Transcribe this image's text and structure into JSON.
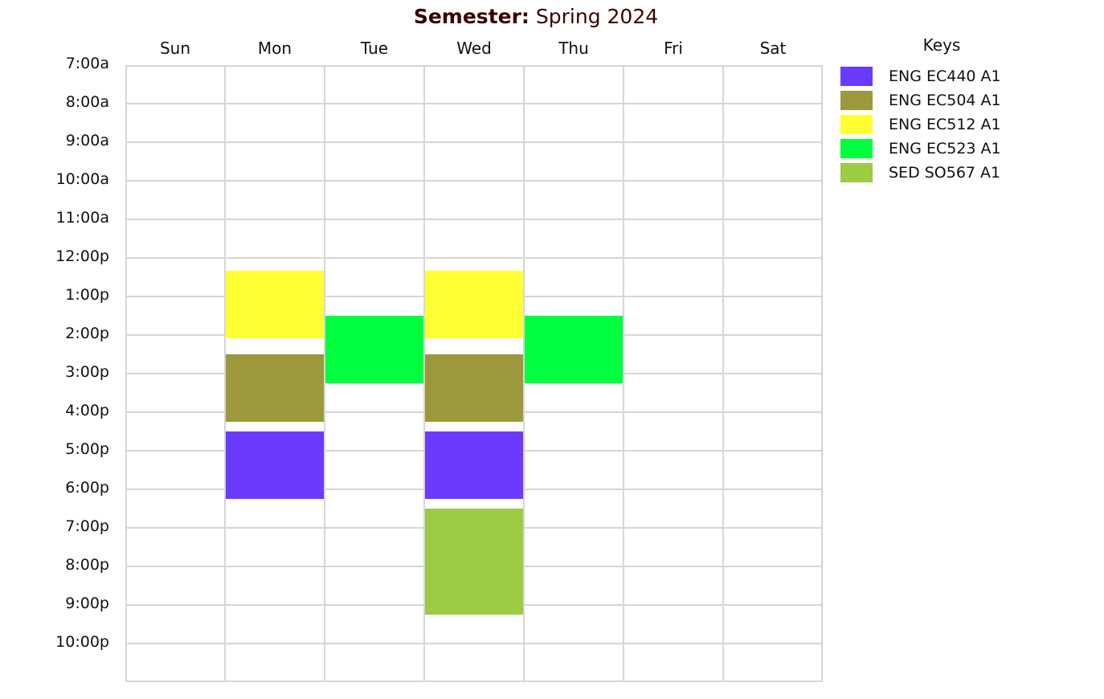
{
  "header": {
    "semester_label": "Semester:",
    "semester_value": "Spring 2024"
  },
  "days": [
    "Sun",
    "Mon",
    "Tue",
    "Wed",
    "Thu",
    "Fri",
    "Sat"
  ],
  "times": [
    "7:00a",
    "8:00a",
    "9:00a",
    "10:00a",
    "11:00a",
    "12:00p",
    "1:00p",
    "2:00p",
    "3:00p",
    "4:00p",
    "5:00p",
    "6:00p",
    "7:00p",
    "8:00p",
    "9:00p",
    "10:00p"
  ],
  "keys": {
    "title": "Keys",
    "items": [
      {
        "label": "ENG EC440 A1",
        "color": "#6a3bff"
      },
      {
        "label": "ENG EC504 A1",
        "color": "#9b993b"
      },
      {
        "label": "ENG EC512 A1",
        "color": "#ffff33"
      },
      {
        "label": "ENG EC523 A1",
        "color": "#00ff3c"
      },
      {
        "label": "SED SO567 A1",
        "color": "#9ccb44"
      }
    ]
  },
  "events": [
    {
      "course": 2,
      "day": 1,
      "start": 12.33,
      "end": 14.08
    },
    {
      "course": 2,
      "day": 3,
      "start": 12.33,
      "end": 14.08
    },
    {
      "course": 3,
      "day": 2,
      "start": 13.5,
      "end": 15.25
    },
    {
      "course": 3,
      "day": 4,
      "start": 13.5,
      "end": 15.25
    },
    {
      "course": 1,
      "day": 1,
      "start": 14.5,
      "end": 16.25
    },
    {
      "course": 1,
      "day": 3,
      "start": 14.5,
      "end": 16.25
    },
    {
      "course": 0,
      "day": 1,
      "start": 16.5,
      "end": 18.25
    },
    {
      "course": 0,
      "day": 3,
      "start": 16.5,
      "end": 18.25
    },
    {
      "course": 4,
      "day": 3,
      "start": 18.5,
      "end": 21.25
    }
  ]
}
